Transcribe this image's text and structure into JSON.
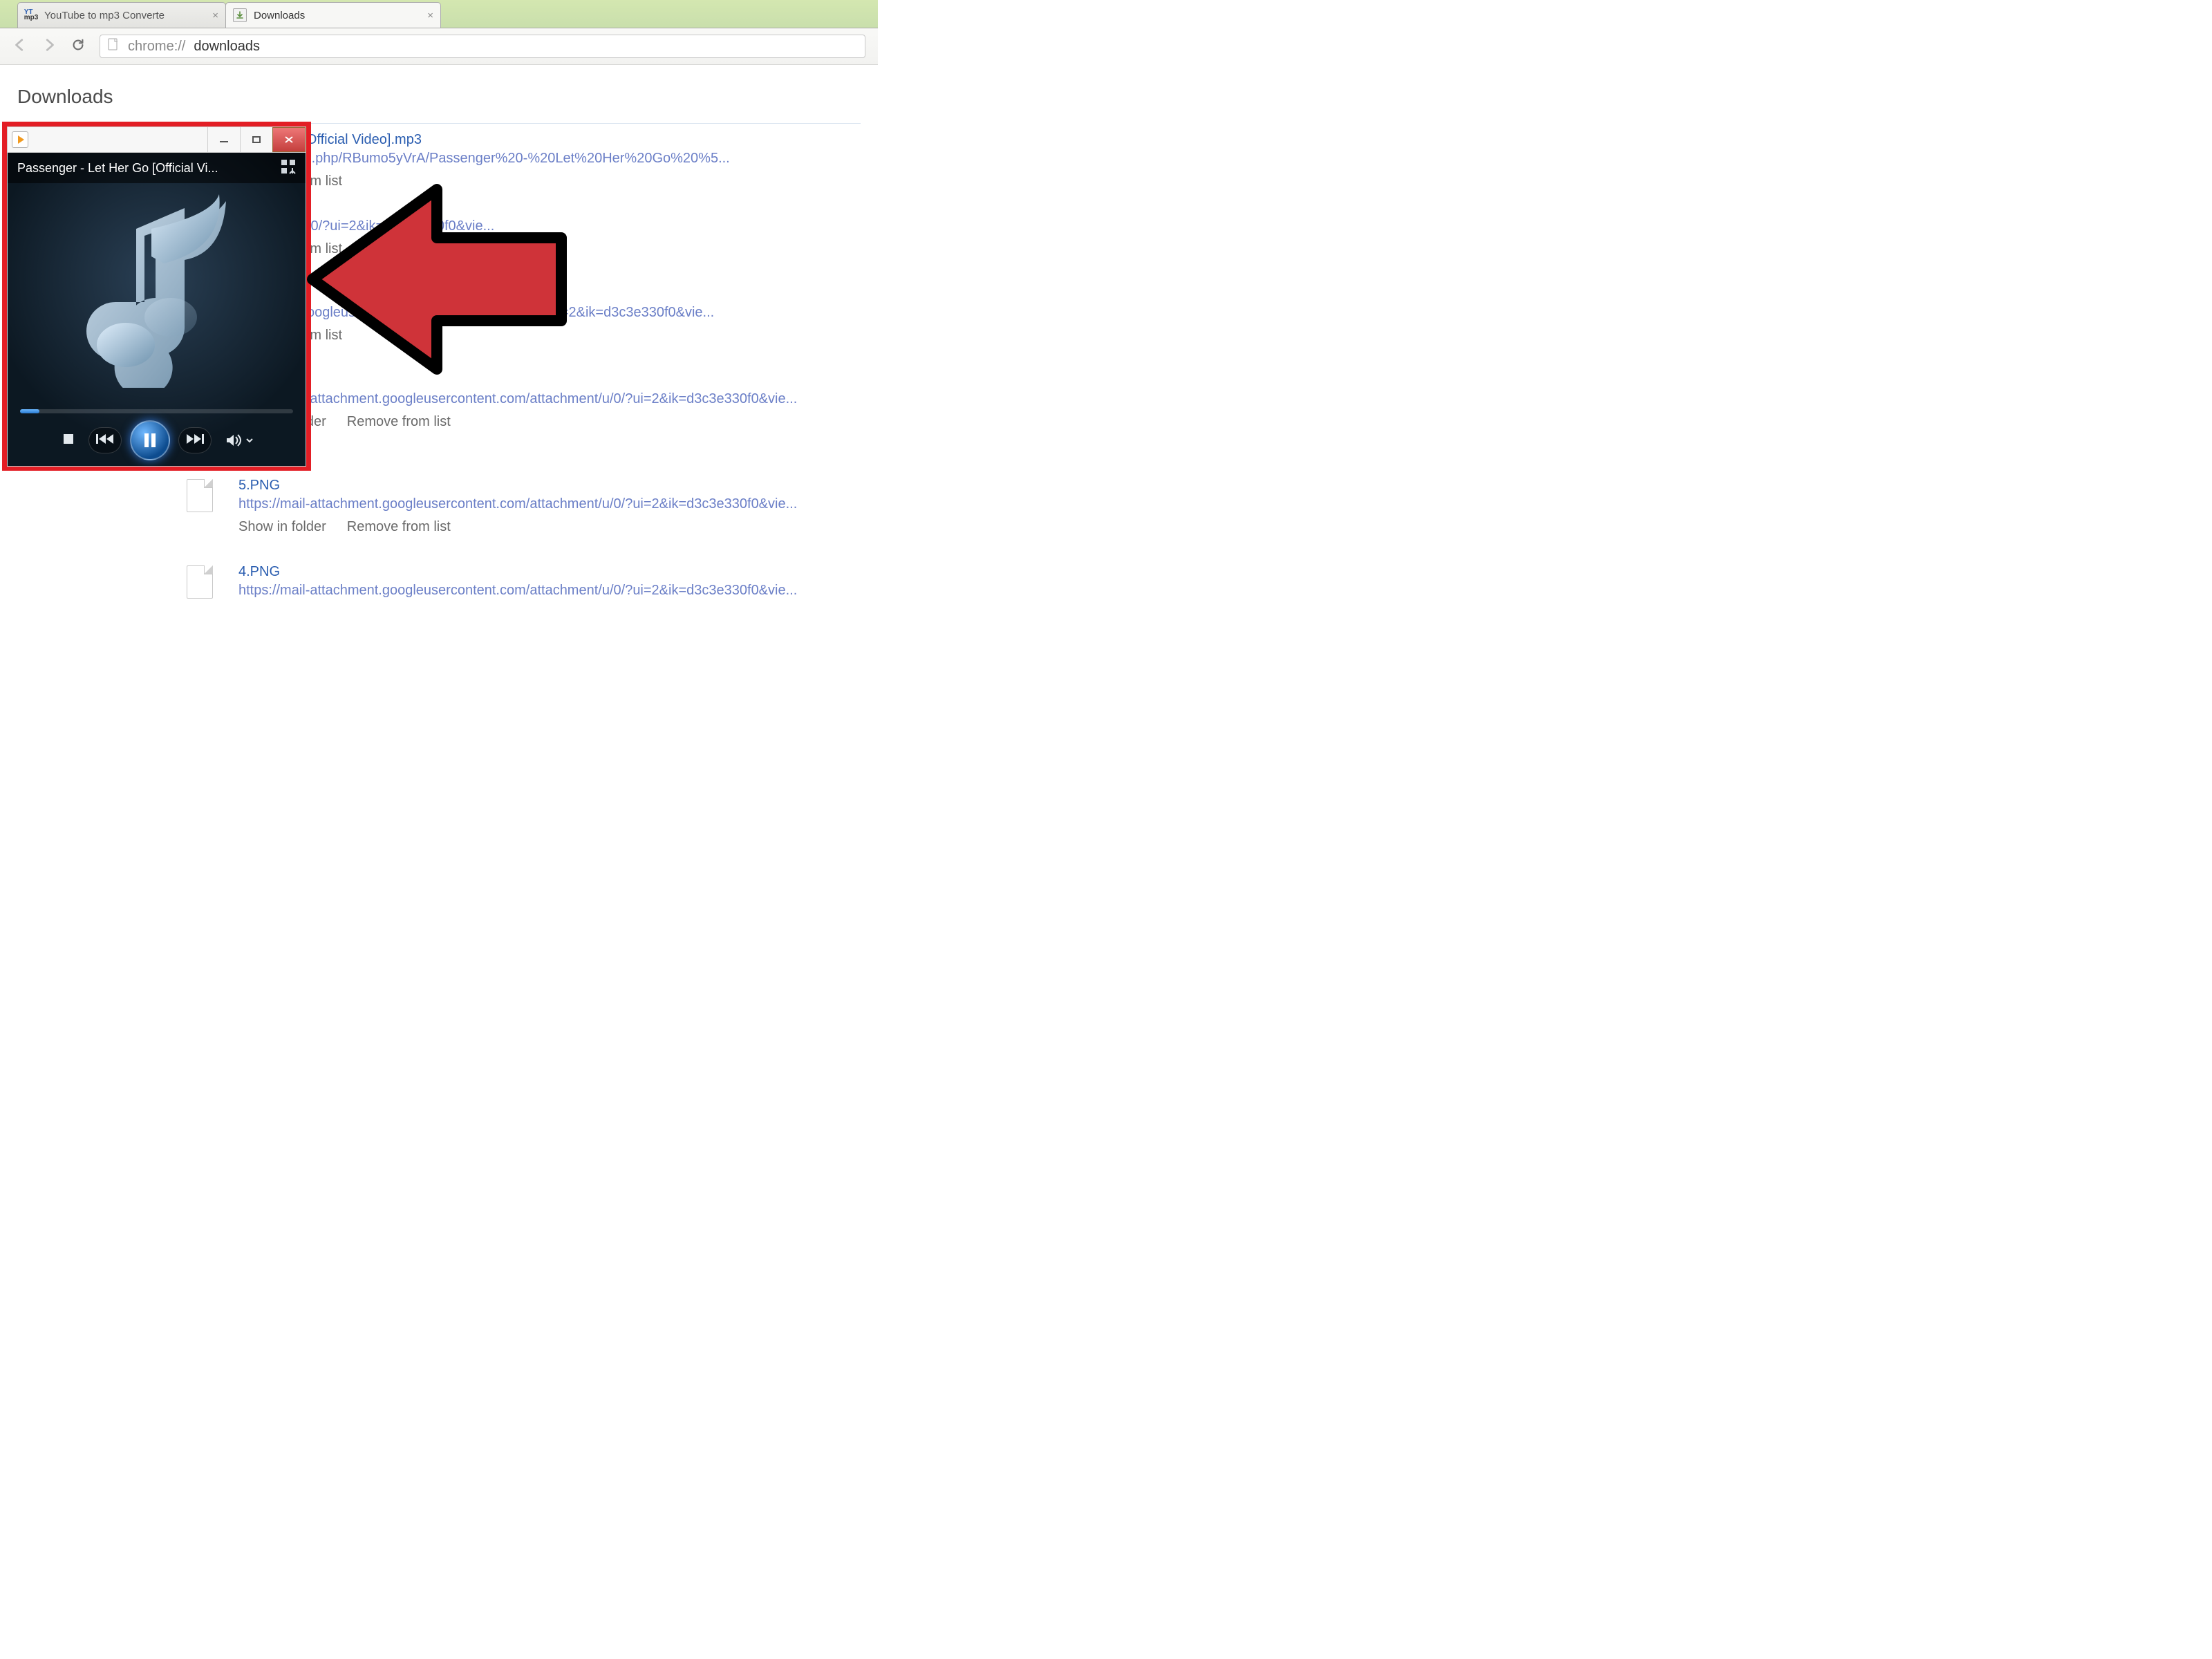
{
  "tabs": {
    "inactive": {
      "favicon_top": "YT",
      "favicon_bottom": "mp3",
      "title": "YouTube to mp3 Converte"
    },
    "active": {
      "title": "Downloads"
    }
  },
  "address_bar": {
    "prefix": "chrome://",
    "page": "downloads"
  },
  "page": {
    "heading": "Downloads"
  },
  "downloads": [
    {
      "filename": "et Her Go [Official Video].mp3",
      "url": "aclst.com/dl.php/RBumo5yVrA/Passenger%20-%20Let%20Her%20Go%20%5...",
      "show": "",
      "remove": "Remove from list"
    },
    {
      "filename": "",
      "url": "tachment/u/0/?ui=2&ik=d3c3e330f0&vie...",
      "show": "",
      "remove": "Remove from list"
    },
    {
      "filename": "",
      "url": "tachment.googleusercontent.com/attachment/u/0/?ui=2&ik=d3c3e330f0&vie...",
      "show": "",
      "remove": "Remove from list"
    },
    {
      "filename": "",
      "url": "https://mail-attachment.googleusercontent.com/attachment/u/0/?ui=2&ik=d3c3e330f0&vie...",
      "show": "Show in folder",
      "remove": "Remove from list"
    },
    {
      "filename": "5.PNG",
      "url": "https://mail-attachment.googleusercontent.com/attachment/u/0/?ui=2&ik=d3c3e330f0&vie...",
      "show": "Show in folder",
      "remove": "Remove from list"
    },
    {
      "filename": "4.PNG",
      "url": "https://mail-attachment.googleusercontent.com/attachment/u/0/?ui=2&ik=d3c3e330f0&vie...",
      "show": "",
      "remove": ""
    }
  ],
  "wmp": {
    "now_playing": "Passenger - Let Her Go [Official Vi..."
  }
}
